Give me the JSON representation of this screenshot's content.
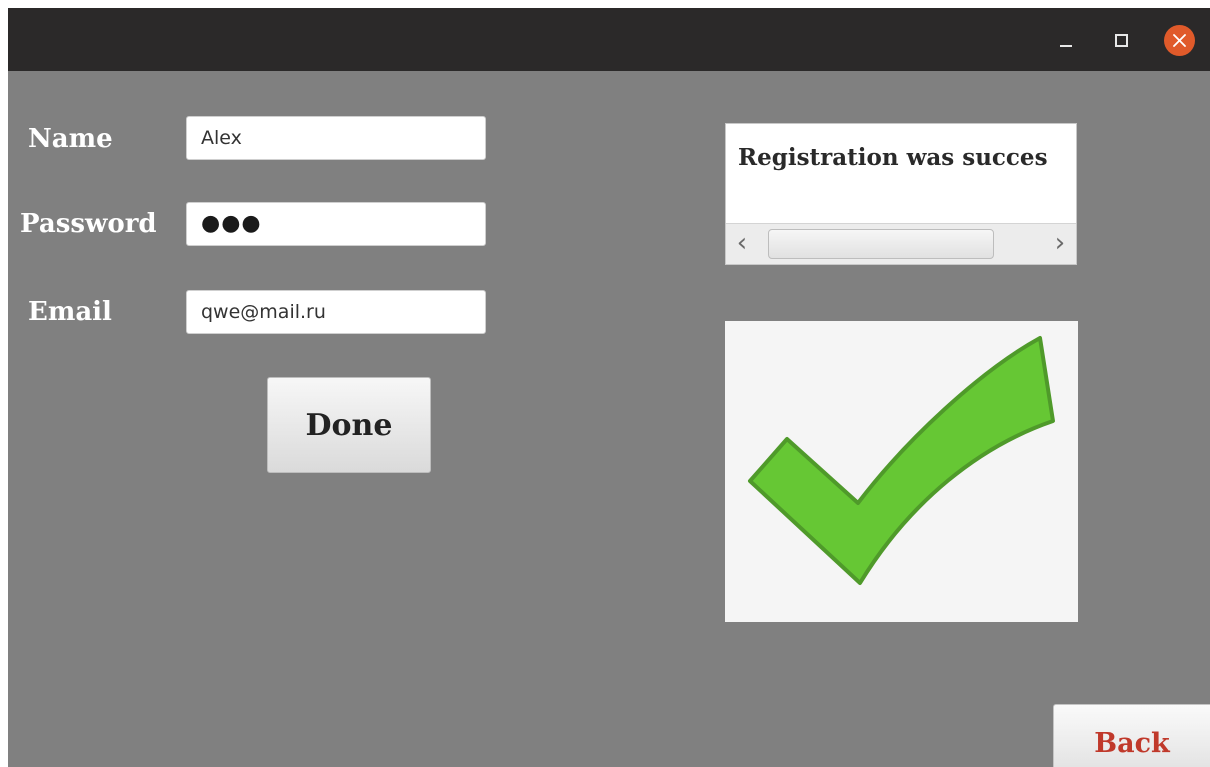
{
  "window": {
    "controls": {
      "minimize_icon": "minimize-icon",
      "maximize_icon": "maximize-icon",
      "close_icon": "close-icon",
      "close_color": "#e05a2a"
    }
  },
  "form": {
    "name_label": "Name",
    "name_value": "Alex",
    "password_label": "Password",
    "password_value": "●●●",
    "email_label": "Email",
    "email_value": "qwe@mail.ru",
    "done_label": "Done"
  },
  "result": {
    "message": "Registration was succes",
    "scroll_left_icon": "chevron-left-icon",
    "scroll_right_icon": "chevron-right-icon",
    "image_icon": "checkmark-icon",
    "check_color": "#66c734"
  },
  "back_label": "Back",
  "colors": {
    "background": "#808080",
    "titlebar": "#2b2929",
    "back_text": "#c0392b"
  }
}
